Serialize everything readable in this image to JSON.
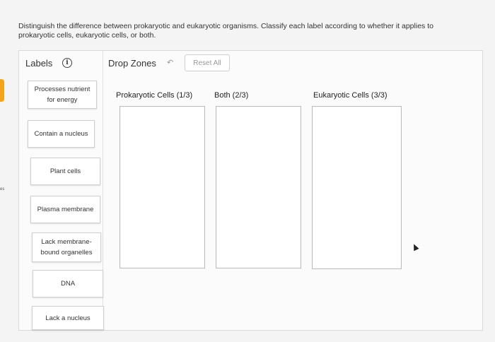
{
  "question": {
    "text": "Distinguish the difference between prokaryotic and eukaryotic organisms. Classify each label according to whether it applies to prokaryotic cells, eukaryotic cells, or both."
  },
  "labels_panel": {
    "title": "Labels",
    "info_icon": "info-circle-icon",
    "items": [
      "Processes nutrient for energy",
      "Contain a nucleus",
      "Plant cells",
      "Plasma membrane",
      "Lack membrane-bound organelles",
      "DNA",
      "Lack a nucleus"
    ]
  },
  "drop_zones": {
    "title": "Drop Zones",
    "undo_icon": "undo-arrow-icon",
    "reset_label": "Reset All",
    "zones": [
      {
        "label": "Prokaryotic Cells (1/3)"
      },
      {
        "label": "Both (2/3)"
      },
      {
        "label": "Eukaryotic Cells (3/3)"
      }
    ]
  },
  "colors": {
    "accent_tab": "#f2a51a",
    "panel_border": "#d9d9d9"
  },
  "edge_text": "es"
}
